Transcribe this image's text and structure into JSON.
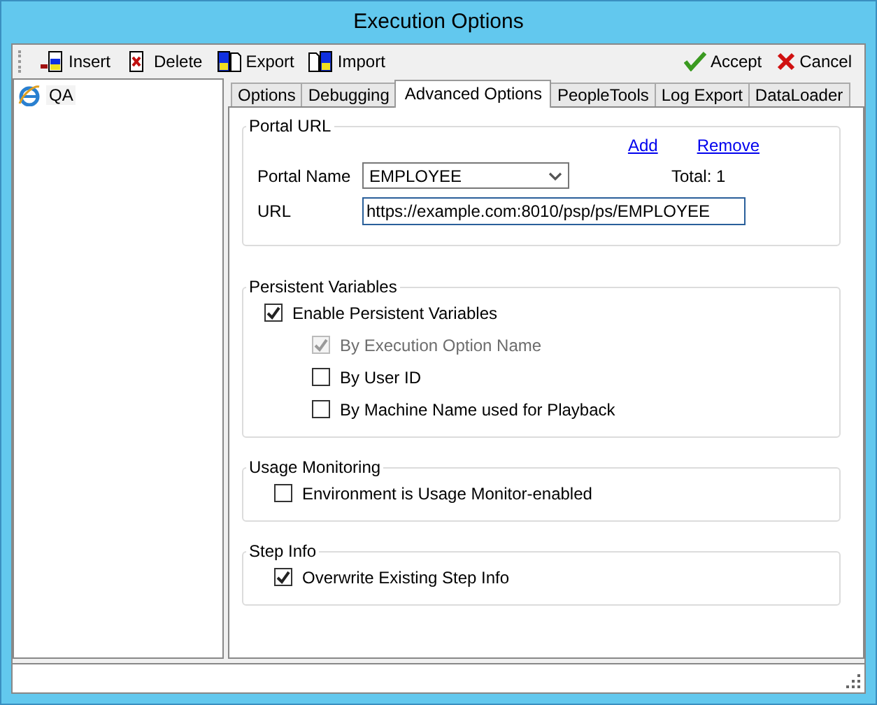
{
  "window": {
    "title": "Execution Options"
  },
  "toolbar": {
    "left": [
      {
        "label": "Insert",
        "kind": "insert"
      },
      {
        "label": "Delete",
        "kind": "delete"
      },
      {
        "label": "Export",
        "kind": "export"
      },
      {
        "label": "Import",
        "kind": "import"
      }
    ],
    "right": [
      {
        "label": "Accept",
        "kind": "accept"
      },
      {
        "label": "Cancel",
        "kind": "cancel"
      }
    ]
  },
  "tree": {
    "items": [
      {
        "label": "QA",
        "selected": true
      }
    ]
  },
  "tabs": [
    {
      "label": "Options",
      "selected": false
    },
    {
      "label": "Debugging",
      "selected": false
    },
    {
      "label": "Advanced Options",
      "selected": true
    },
    {
      "label": "PeopleTools",
      "selected": false
    },
    {
      "label": "Log Export",
      "selected": false
    },
    {
      "label": "DataLoader",
      "selected": false
    }
  ],
  "portal_url": {
    "title": "Portal URL",
    "links": [
      "Add",
      "Remove"
    ],
    "portal_name_label": "Portal Name",
    "portal_name": "EMPLOYEE",
    "total": "Total: 1",
    "url_label": "URL",
    "url": "https://example.com:8010/psp/ps/EMPLOYEE"
  },
  "sections": [
    {
      "title": "Persistent Variables",
      "options": [
        {
          "label": "Enable Persistent Variables",
          "checked": true,
          "disabled": false,
          "children": [
            {
              "label": "By Execution Option Name",
              "checked": true,
              "disabled": true
            },
            {
              "label": "By User ID",
              "checked": false,
              "disabled": false
            },
            {
              "label": "By Machine Name used for Playback",
              "checked": false,
              "disabled": false
            }
          ]
        }
      ]
    },
    {
      "title": "Usage Monitoring",
      "options": [
        {
          "label": "Environment is Usage Monitor-enabled",
          "checked": false,
          "disabled": false
        }
      ]
    },
    {
      "title": "Step Info",
      "options": [
        {
          "label": "Overwrite Existing Step Info",
          "checked": true,
          "disabled": false
        }
      ]
    }
  ]
}
